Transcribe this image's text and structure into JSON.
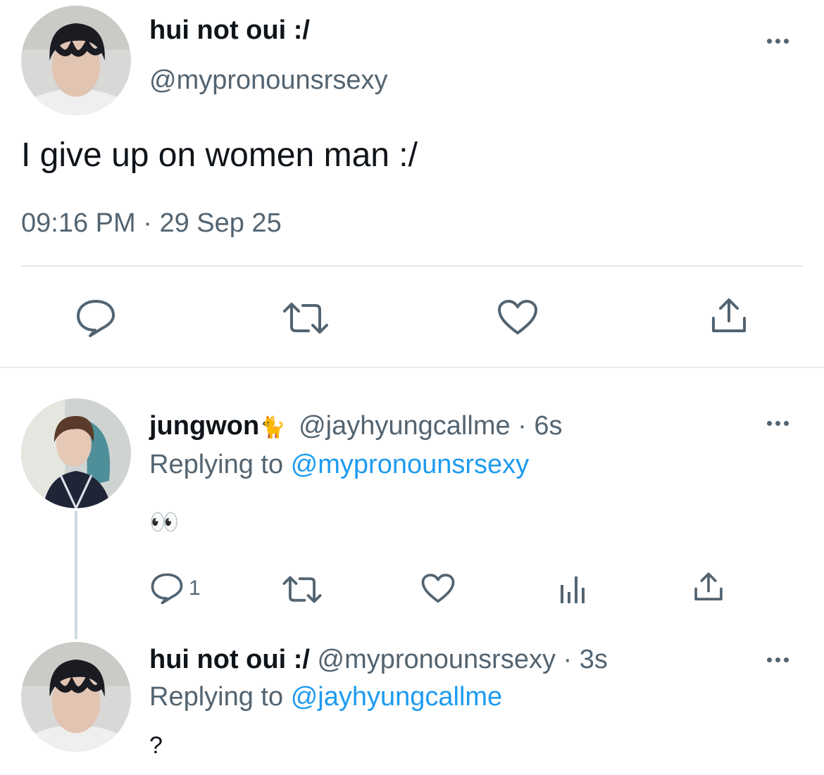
{
  "main_tweet": {
    "display_name": "hui not oui :/",
    "handle": "@mypronounsrsexy",
    "text": "I give up on women man :/",
    "time": "09:16 PM",
    "separator": "·",
    "date": "29 Sep 25",
    "actions": {
      "reply": "reply-icon",
      "retweet": "retweet-icon",
      "like": "heart-icon",
      "share": "share-icon"
    }
  },
  "reply_1": {
    "display_name": "jungwon",
    "name_emoji": "🐈",
    "handle": "@jayhyungcallme",
    "separator": "·",
    "age": "6s",
    "replying_prefix": "Replying to",
    "replying_handle": "@mypronounsrsexy",
    "text": "👀",
    "reply_count": "1"
  },
  "reply_2": {
    "display_name": "hui not oui :/",
    "handle": "@mypronounsrsexy",
    "separator": "·",
    "age": "3s",
    "replying_prefix": "Replying to",
    "replying_handle": "@jayhyungcallme",
    "text": "?"
  },
  "colors": {
    "text": "#0f1419",
    "muted": "#536471",
    "link": "#1d9bf0",
    "divider": "#e7e9ea"
  }
}
